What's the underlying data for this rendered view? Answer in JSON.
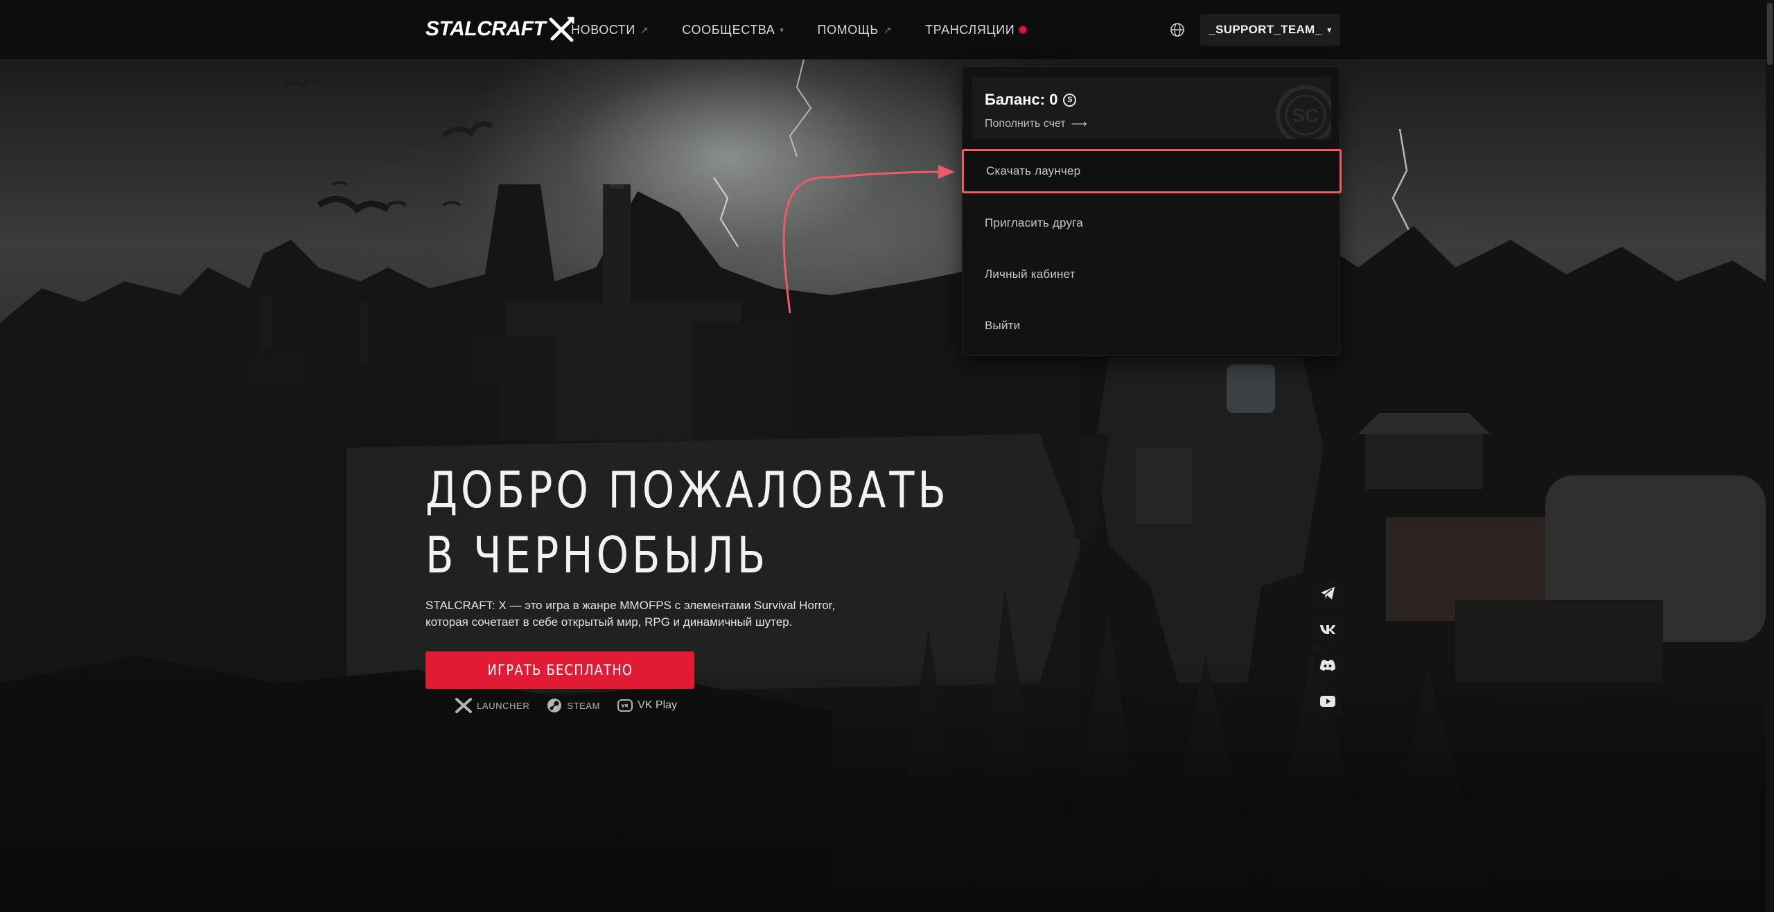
{
  "header": {
    "logo_text": "STALCRAFT",
    "nav": [
      {
        "label": "НОВОСТИ",
        "marker": "↗"
      },
      {
        "label": "СООБЩЕСТВА",
        "marker": "▾"
      },
      {
        "label": "ПОМОЩЬ",
        "marker": "↗"
      },
      {
        "label": "ТРАНСЛЯЦИИ",
        "marker": "live-dot"
      }
    ],
    "username": "_SUPPORT_TEAM_",
    "user_caret": "▾"
  },
  "dropdown": {
    "balance_label": "Баланс: 0",
    "coin_symbol": "S",
    "topup_label": "Пополнить счет",
    "topup_arrow": "⟶",
    "watermark": "SC",
    "items": [
      {
        "label": "Скачать лаунчер",
        "highlighted": true
      },
      {
        "label": "Пригласить друга"
      },
      {
        "label": "Личный кабинет"
      },
      {
        "label": "Выйти"
      }
    ]
  },
  "hero": {
    "title_line1": "ДОБРО ПОЖАЛОВАТЬ",
    "title_line2": "В ЧЕРНОБЫЛЬ",
    "description_line1": "STALCRAFT: X — это игра в жанре MMOFPS с элементами Survival Horror,",
    "description_line2": "которая сочетает в себе открытый мир, RPG и динамичный шутер.",
    "play_button": "ИГРАТЬ БЕСПЛАТНО",
    "platforms": [
      {
        "label": "LAUNCHER",
        "icon": "launcher-x-icon"
      },
      {
        "label": "STEAM",
        "icon": "steam-icon"
      },
      {
        "label": "VK Play",
        "icon": "vk-play-icon"
      }
    ]
  },
  "social": [
    "telegram-icon",
    "vk-icon",
    "discord-icon",
    "youtube-icon"
  ],
  "colors": {
    "accent": "#e21b35",
    "highlight_border": "#ef5a6a",
    "live_dot": "#e21b3c",
    "background": "#0b0b0b"
  }
}
